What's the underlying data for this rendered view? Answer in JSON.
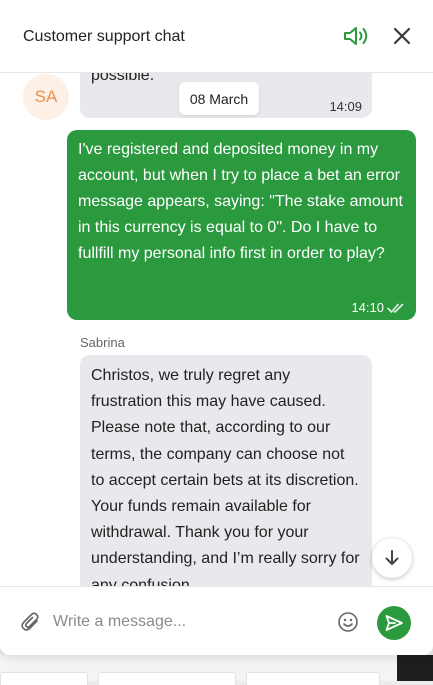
{
  "header": {
    "title": "Customer support chat",
    "sound_icon": "speaker-volume-icon",
    "close_icon": "close-icon"
  },
  "messages": [
    {
      "type": "incoming",
      "avatar_initials": "SA",
      "text": "possible.",
      "time": "14:09"
    },
    {
      "type": "date_separator",
      "label": "08 March"
    },
    {
      "type": "outgoing",
      "text": "I've registered and deposited money in my account, but when I try to place a bet an error message appears, saying: \"The stake amount in this currency is equal to 0\". Do I have to fullfill my personal info first in order to play?",
      "time": "14:10",
      "status_icon": "double-check-icon"
    },
    {
      "type": "incoming",
      "sender": "Sabrina",
      "text": "Christos, we truly regret any frustration this may have caused. Please note that, according to our terms, the company can choose not to accept certain bets at its discretion. Your funds remain available for withdrawal. Thank you for your understanding, and I’m really sorry for any confusion."
    }
  ],
  "composer": {
    "placeholder": "Write a message...",
    "value": "",
    "attach_icon": "paperclip-icon",
    "emoji_icon": "smiley-icon",
    "send_icon": "send-icon"
  },
  "scroll_down_icon": "arrow-down-icon",
  "colors": {
    "accent": "#2b9a3f",
    "incoming_bubble": "#e8e9ec",
    "avatar_bg": "#fdf0e6",
    "avatar_text": "#e8904d"
  }
}
